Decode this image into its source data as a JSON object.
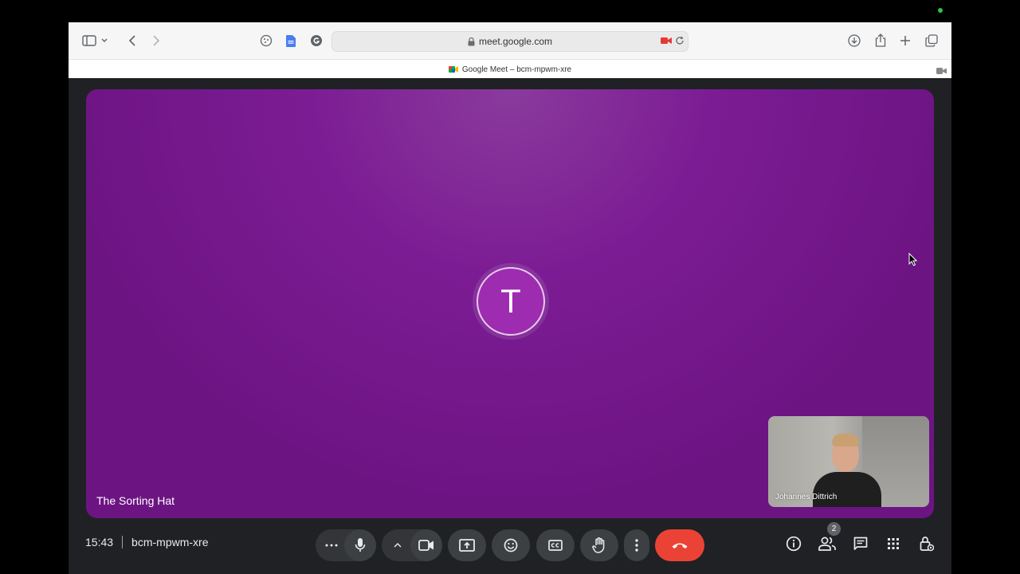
{
  "browser": {
    "url": "meet.google.com",
    "tab_title": "Google Meet – bcm-mpwm-xre"
  },
  "meeting": {
    "time": "15:43",
    "code": "bcm-mpwm-xre",
    "main_participant": {
      "name": "The Sorting Hat",
      "initial": "T",
      "color": "#9d2cb0"
    },
    "self_participant": {
      "name": "Johannes Dittrich"
    },
    "participant_count": "2"
  },
  "controls": {
    "icons": [
      "more-options-icon",
      "microphone-icon",
      "chevron-up-icon",
      "camera-icon",
      "present-screen-icon",
      "emoji-icon",
      "captions-icon",
      "raise-hand-icon",
      "more-vert-icon",
      "hang-up-icon"
    ],
    "right_icons": [
      "info-icon",
      "people-icon",
      "chat-icon",
      "activities-icon",
      "host-controls-icon"
    ],
    "hangup_color": "#ea4335"
  }
}
